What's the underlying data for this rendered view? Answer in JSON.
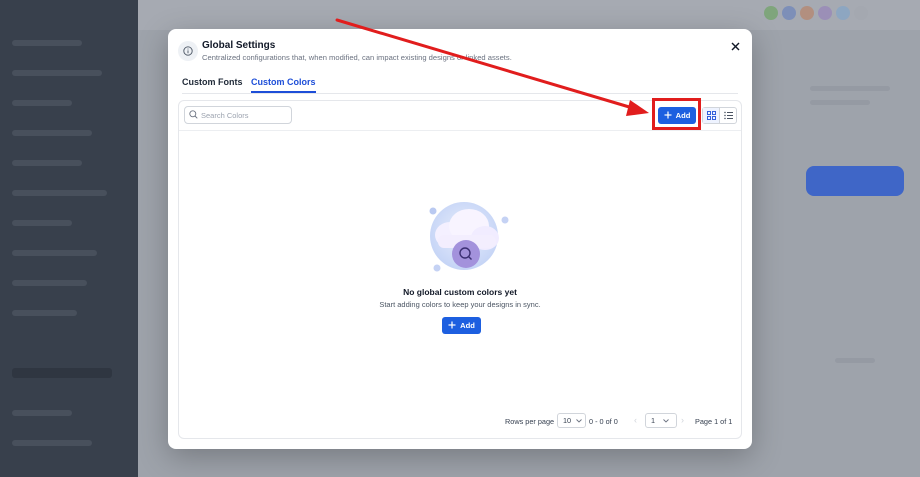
{
  "modal": {
    "title": "Global Settings",
    "subtitle": "Centralized configurations that, when modified, can impact existing designs or linked assets.",
    "tabs": [
      {
        "label": "Custom Fonts",
        "active": false
      },
      {
        "label": "Custom Colors",
        "active": true
      }
    ]
  },
  "toolbar": {
    "search_placeholder": "Search Colors",
    "add_label": "Add",
    "view_modes": [
      "grid",
      "list"
    ],
    "active_view": "grid"
  },
  "empty_state": {
    "title": "No global custom colors yet",
    "subtitle": "Start adding colors to keep your designs in sync.",
    "add_label": "Add"
  },
  "pagination": {
    "rows_per_page_label": "Rows per page",
    "rows_per_page": "10",
    "range": "0 - 0 of 0",
    "page": "1",
    "page_of": "Page 1 of 1"
  },
  "colors": {
    "accent": "#1d5fe0",
    "annotation": "#e11d1d"
  },
  "icons": {
    "header": "info-icon",
    "close": "close-icon",
    "search": "search-icon",
    "add": "plus-icon",
    "grid": "grid-view-icon",
    "list": "list-view-icon"
  }
}
